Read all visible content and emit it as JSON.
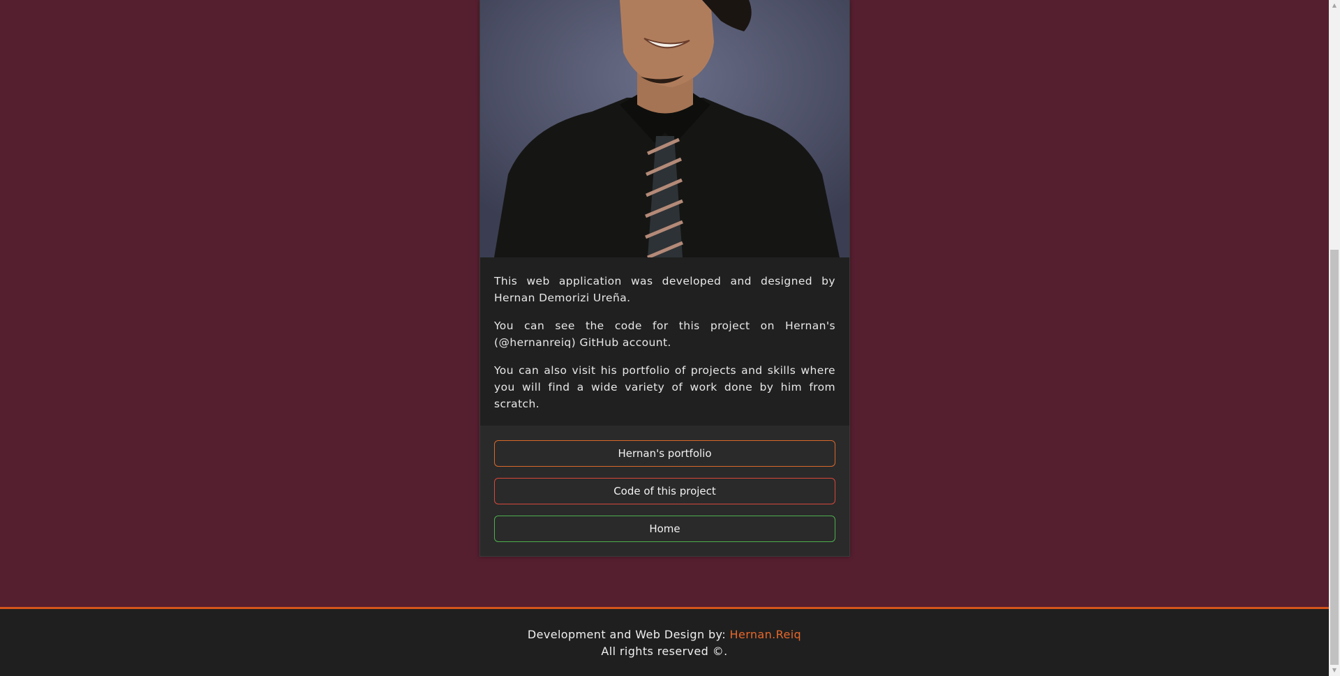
{
  "about": {
    "paragraphs": [
      "This web application was developed and designed by Hernan Demorizi Ureña.",
      "You can see the code for this project on Hernan's (@hernanreiq) GitHub account.",
      "You can also visit his portfolio of projects and skills where you will find a wide variety of work done by him from scratch."
    ],
    "photo_icon": "author-photo"
  },
  "buttons": {
    "portfolio": "Hernan's portfolio",
    "code": "Code of this project",
    "home": "Home"
  },
  "footer": {
    "prefix": "Development and Web Design by: ",
    "brand": "Hernan.Reiq",
    "rights": "All rights reserved ©."
  },
  "colors": {
    "background": "#561f30",
    "accent": "#e8672a",
    "portfolio_border": "#d9692a",
    "code_border": "#d9483a",
    "home_border": "#4fb04f"
  }
}
